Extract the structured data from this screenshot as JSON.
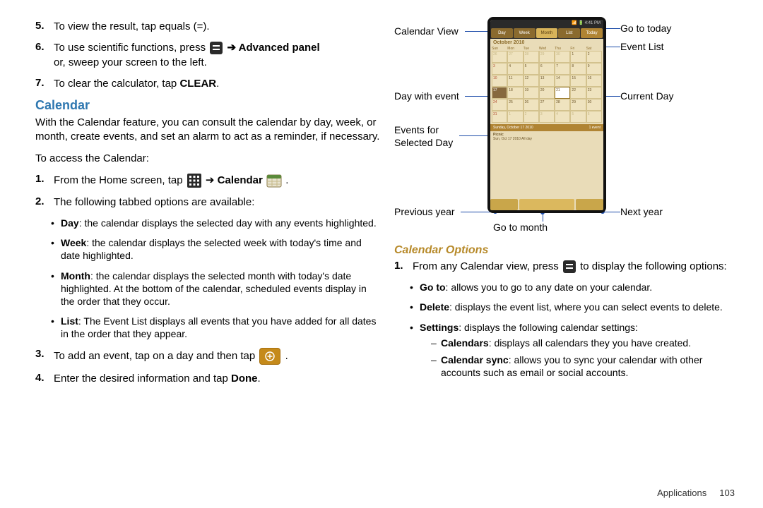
{
  "left": {
    "steps_top": [
      {
        "n": "5.",
        "t": "To view the result, tap equals (=)."
      },
      {
        "n": "6.",
        "pre": "To use scientific functions, press ",
        "post": " ➔ Advanced panel",
        "post2": "or, sweep your screen to the left."
      },
      {
        "n": "7.",
        "pre": "To clear the calculator, tap ",
        "bold": "CLEAR",
        "post": "."
      }
    ],
    "section": "Calendar",
    "intro": "With the Calendar feature, you can consult the calendar by day, week, or month, create events, and set an alarm to act as a reminder, if necessary.",
    "access": "To access the Calendar:",
    "steps_cal": [
      {
        "n": "1.",
        "pre": "From the Home screen, tap ",
        "mid": " ➔ ",
        "bold": "Calendar",
        "post": " ."
      },
      {
        "n": "2.",
        "t": "The following tabbed options are available:"
      }
    ],
    "tabs": [
      {
        "b": "Day",
        "t": ": the calendar displays the selected day with any events highlighted."
      },
      {
        "b": "Week",
        "t": ": the calendar displays the selected week with today's time and date highlighted."
      },
      {
        "b": "Month",
        "t": ": the calendar displays the selected month with today's date highlighted. At the bottom of the calendar, scheduled events display in the order that they occur."
      },
      {
        "b": "List",
        "t": ": The Event List displays all events that you have added for all dates in the order that they appear."
      }
    ],
    "steps_after": [
      {
        "n": "3.",
        "pre": "To add an event, tap on a day and then tap ",
        "post": " ."
      },
      {
        "n": "4.",
        "pre": "Enter the desired information and tap ",
        "bold": "Done",
        "post": "."
      }
    ]
  },
  "right": {
    "callouts": {
      "calendar_view": "Calendar View",
      "day_with_event": "Day with event",
      "events_for": "Events for",
      "selected_day": "Selected Day",
      "previous_year": "Previous year",
      "go_to_month": "Go to month",
      "go_to_today": "Go to today",
      "event_list": "Event List",
      "current_day": "Current Day",
      "next_year": "Next year"
    },
    "phone": {
      "time": "4:41 PM",
      "tabs": [
        "Day",
        "Week",
        "Month",
        "List",
        "Today"
      ],
      "month": "October 2010",
      "dow": [
        "Sun",
        "Mon",
        "Tue",
        "Wed",
        "Thu",
        "Fri",
        "Sat"
      ],
      "ev_hdr_l": "Sunday, October 17 2010",
      "ev_hdr_r": "1 event",
      "ev_title": "Picnic",
      "ev_sub": "Sun, Oct 17 2010  All day"
    },
    "subsection": "Calendar Options",
    "step1_pre": "From any Calendar view, press ",
    "step1_post": " to display the following options:",
    "opts": [
      {
        "b": "Go to",
        "t": ": allows you to go to any date on your calendar."
      },
      {
        "b": "Delete",
        "t": ": displays the event list, where you can select events to delete."
      },
      {
        "b": "Settings",
        "t": ": displays the following calendar settings:"
      }
    ],
    "subopts": [
      {
        "b": "Calendars",
        "t": ": displays all calendars they you have created."
      },
      {
        "b": "Calendar sync",
        "t": ": allows you to sync your calendar with other accounts such as email or social accounts."
      }
    ]
  },
  "footer": {
    "section": "Applications",
    "page": "103"
  }
}
